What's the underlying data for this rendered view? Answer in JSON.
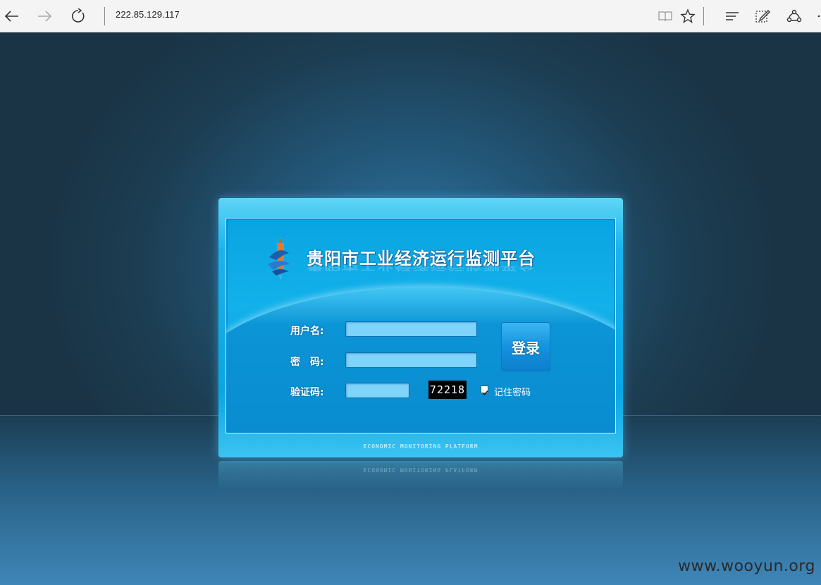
{
  "browser": {
    "address": "222.85.129.117",
    "icons": [
      "back-icon",
      "forward-icon",
      "refresh-icon",
      "reading-view-icon",
      "favorite-star-icon",
      "hub-icon",
      "web-note-icon",
      "share-icon",
      "more-icon"
    ]
  },
  "login": {
    "title": "贵阳市工业经济运行监测平台",
    "username_label": "用户名:",
    "password_label": "密　码:",
    "captcha_label": "验证码:",
    "username_value": "",
    "password_value": "",
    "captcha_value": "",
    "login_button": "登录",
    "captcha_code": "72218",
    "remember_label": "记住密码",
    "remember_checked": true,
    "footer": "ECONOMIC MONITORING PLATFORM"
  },
  "watermark": "www.wooyun.org",
  "colors": {
    "panel": "#0aa6e3",
    "field": "#7fd4fb",
    "background": "#1f3f52"
  }
}
